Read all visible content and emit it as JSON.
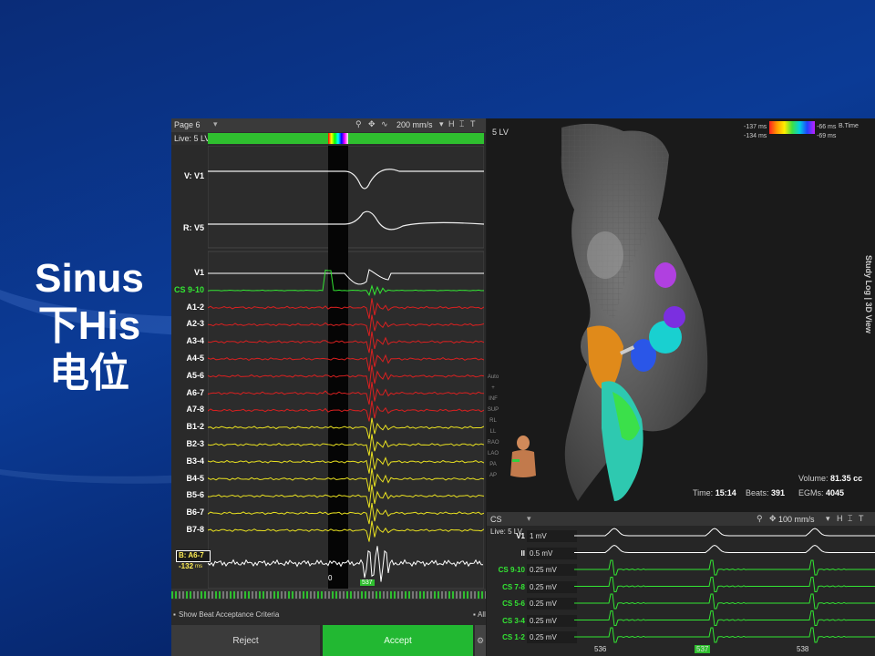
{
  "slide": {
    "line1": "Sinus",
    "line2": "下His",
    "line3": "电位"
  },
  "left_panel": {
    "page": "Page 6",
    "live": "Live: 5 LV",
    "speed": "200 mm/s",
    "ref_channels": [
      {
        "name": "V: V1",
        "color": "#ffffff"
      },
      {
        "name": "R: V5",
        "color": "#ffffff"
      }
    ],
    "channels": [
      {
        "name": "V1",
        "color": "#ffffff",
        "suffix": "V"
      },
      {
        "name": "CS 9-10",
        "color": "#33e633"
      },
      {
        "name": "A1-2",
        "color": "#ffffff"
      },
      {
        "name": "A2-3",
        "color": "#ffffff"
      },
      {
        "name": "A3-4",
        "color": "#ffffff"
      },
      {
        "name": "A4-5",
        "color": "#ffffff"
      },
      {
        "name": "A5-6",
        "color": "#ffffff"
      },
      {
        "name": "A6-7",
        "color": "#ffffff"
      },
      {
        "name": "A7-8",
        "color": "#ffffff"
      },
      {
        "name": "B1-2",
        "color": "#ffffff"
      },
      {
        "name": "B2-3",
        "color": "#ffffff"
      },
      {
        "name": "B3-4",
        "color": "#ffffff"
      },
      {
        "name": "B4-5",
        "color": "#ffffff"
      },
      {
        "name": "B5-6",
        "color": "#ffffff"
      },
      {
        "name": "B6-7",
        "color": "#ffffff"
      },
      {
        "name": "B7-8",
        "color": "#ffffff"
      }
    ],
    "lat_channel": "B: A6-7",
    "lat_value": "-132",
    "lat_unit": "ms",
    "zero_marker": "0",
    "beat_marker": "537",
    "show_criteria": "Show Beat Acceptance Criteria",
    "all_label": "All",
    "reject_label": "Reject",
    "accept_label": "Accept"
  },
  "map_panel": {
    "title": "5 LV",
    "scale_tl": "-137 ms",
    "scale_bl": "-134 ms",
    "scale_tr": "-66 ms",
    "scale_br": "-69 ms",
    "btime": "B.Time",
    "study_log": "Study Log | 3D View",
    "view_buttons": [
      "Auto",
      "+",
      "INF",
      "SUP",
      "RL",
      "LL",
      "RAO",
      "LAO",
      "PA",
      "AP"
    ],
    "time_label": "Time:",
    "time_value": "15:14",
    "beats_label": "Beats:",
    "beats_value": "391",
    "volume_label": "Volume:",
    "volume_value": "81.35 cc",
    "egms_label": "EGMs:",
    "egms_value": "4045"
  },
  "cs_panel": {
    "title": "CS",
    "speed": "100 mm/s",
    "live": "Live: 5 LV",
    "channels": [
      {
        "name": "V1",
        "scale": "1 mV",
        "color": "#ffffff"
      },
      {
        "name": "II",
        "scale": "0.5 mV",
        "color": "#ffffff"
      },
      {
        "name": "CS 9-10",
        "scale": "0.25 mV",
        "color": "#33e633"
      },
      {
        "name": "CS 7-8",
        "scale": "0.25 mV",
        "color": "#33e633"
      },
      {
        "name": "CS 5-6",
        "scale": "0.25 mV",
        "color": "#33e633"
      },
      {
        "name": "CS 3-4",
        "scale": "0.25 mV",
        "color": "#33e633"
      },
      {
        "name": "CS 1-2",
        "scale": "0.25 mV",
        "color": "#33e633"
      }
    ],
    "beat_numbers": [
      "536",
      "537",
      "538"
    ]
  },
  "colors": {
    "red_trace": "#d92020",
    "yellow_trace": "#e8e020",
    "green_trace": "#33e633",
    "accept": "#22b832"
  }
}
